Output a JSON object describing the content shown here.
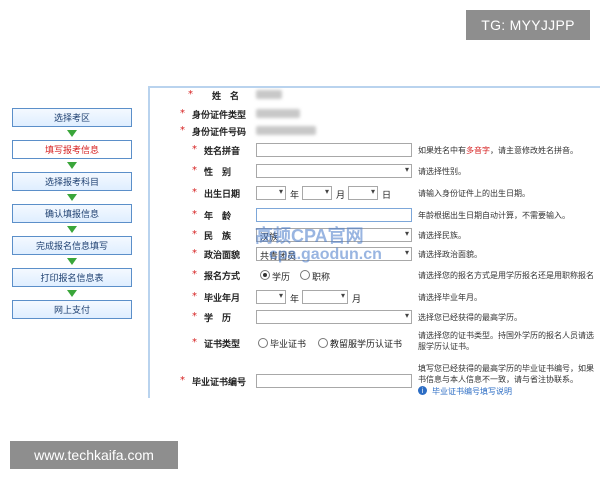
{
  "badges": {
    "tg": "TG: MYYJJPP",
    "site": "www.techkaifa.com"
  },
  "steps": [
    {
      "label": "选择考区",
      "active": false
    },
    {
      "label": "填写报考信息",
      "active": true
    },
    {
      "label": "选择报考科目",
      "active": false
    },
    {
      "label": "确认填报信息",
      "active": false
    },
    {
      "label": "完成报名信息填写",
      "active": false
    },
    {
      "label": "打印报名信息表",
      "active": false
    },
    {
      "label": "网上支付",
      "active": false
    }
  ],
  "form": {
    "name_label": "姓　名",
    "id_type_label": "身份证件类型",
    "id_number_label": "身份证件号码",
    "pinyin_label": "姓名拼音",
    "pinyin_hint_pre": "如果姓名中有",
    "pinyin_hint_red": "多音字",
    "pinyin_hint_post": "，请主意修改姓名拼音。",
    "gender_label": "性　别",
    "gender_hint": "请选择性别。",
    "birth_label": "出生日期",
    "unit_year": "年",
    "unit_month": "月",
    "unit_day": "日",
    "birth_hint": "请输入身份证件上的出生日期。",
    "age_label": "年　龄",
    "age_hint": "年龄根据出生日期自动计算，不需要输入。",
    "ethnic_label": "民　族",
    "ethnic_value": "汉族",
    "ethnic_hint": "请选择民族。",
    "political_label": "政治面貌",
    "political_value": "共青团员",
    "political_hint": "请选择政治面貌。",
    "signup_label": "报名方式",
    "signup_opt1": "学历",
    "signup_opt2": "职称",
    "signup_hint": "请选择您的报名方式是用学历报名还是用职称报名",
    "grad_label": "毕业年月",
    "grad_hint": "请选择毕业年月。",
    "edu_label": "学　历",
    "edu_hint": "选择您已经获得的最高学历。",
    "cert_type_label": "证书类型",
    "cert_opt1": "毕业证书",
    "cert_opt2": "教留服学历认证书",
    "cert_hint1": "请选择您的证书类型。持国外学历的报名人员请选",
    "cert_hint2": "服学历认证书。",
    "cert_num_label": "毕业证书编号",
    "cert_num_hint1": "填写您已经获得的最高学历的毕业证书编号，如果",
    "cert_num_hint2": "书信息与本人信息不一致，请与省注协联系。",
    "cert_num_link": "毕业证书编号填写说明"
  },
  "watermark": {
    "line1": "高顿CPA官网",
    "line2": "cpa.gaodun.cn"
  },
  "colors": {
    "star": "#d62020",
    "step_border": "#5b8fc9",
    "arrow": "#3aa63a",
    "link": "#2c6dc4"
  }
}
